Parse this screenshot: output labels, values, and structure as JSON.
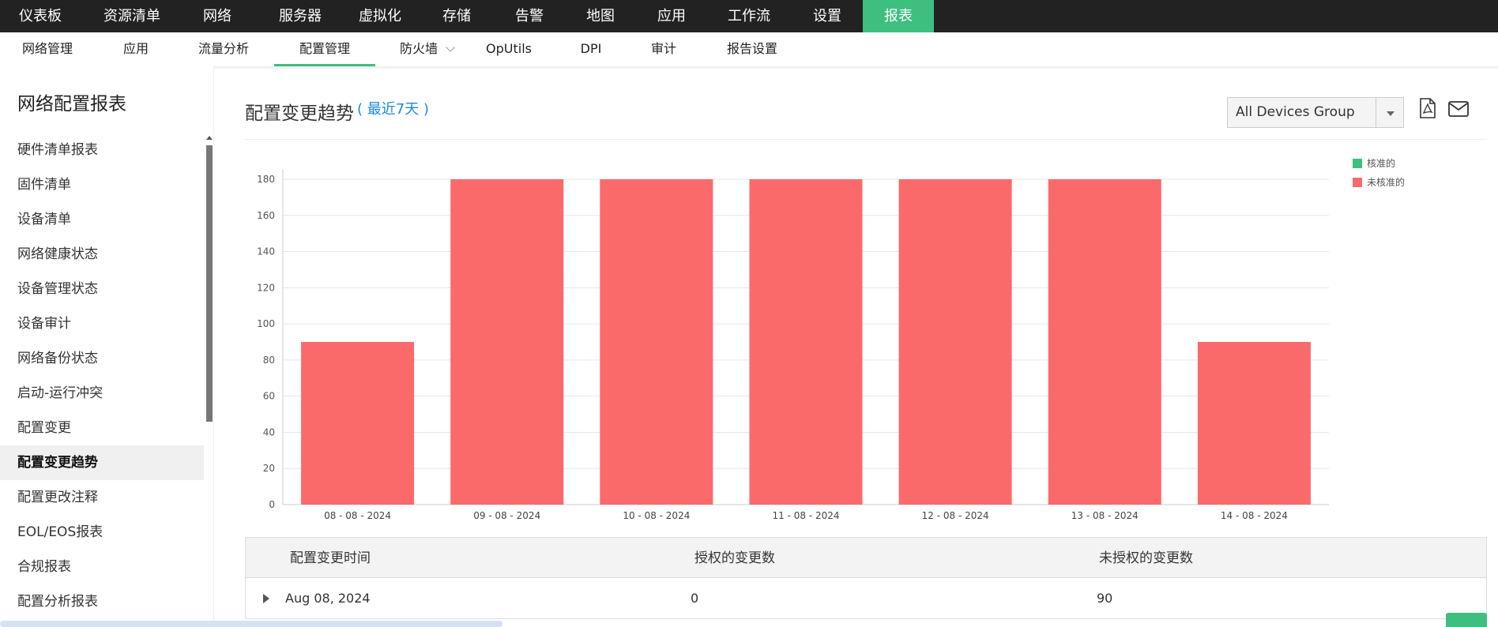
{
  "topnav": {
    "items": [
      "仪表板",
      "资源清单",
      "网络",
      "服务器",
      "虚拟化",
      "存储",
      "告警",
      "地图",
      "应用",
      "工作流",
      "设置",
      "报表"
    ],
    "active": "报表"
  },
  "subnav": {
    "items": [
      "网络管理",
      "应用",
      "流量分析",
      "配置管理",
      "防火墙",
      "OpUtils",
      "DPI",
      "审计",
      "报告设置"
    ],
    "active": "配置管理"
  },
  "sidebar": {
    "title": "网络配置报表",
    "items": [
      "硬件清单报表",
      "固件清单",
      "设备清单",
      "网络健康状态",
      "设备管理状态",
      "设备审计",
      "网络备份状态",
      "启动-运行冲突",
      "配置变更",
      "配置变更趋势",
      "配置更改注释",
      "EOL/EOS报表",
      "合规报表",
      "配置分析报表"
    ],
    "active": "配置变更趋势"
  },
  "main": {
    "title": "配置变更趋势",
    "period": "( 最近7天 )",
    "device_group": "All Devices Group",
    "icons": [
      "pdf-icon",
      "mail-icon"
    ]
  },
  "colors": {
    "accent": "#3fbf7f",
    "authorized": "#3fbf7f",
    "unauthorized": "#fb6a6a",
    "link": "#1e88e5"
  },
  "chart_data": {
    "type": "bar",
    "stacked": true,
    "categories": [
      "08 - 08 - 2024",
      "09 - 08 - 2024",
      "10 - 08 - 2024",
      "11 - 08 - 2024",
      "12 - 08 - 2024",
      "13 - 08 - 2024",
      "14 - 08 - 2024"
    ],
    "series": [
      {
        "name": "核准的",
        "values": [
          0,
          0,
          0,
          0,
          0,
          0,
          0
        ]
      },
      {
        "name": "未核准的",
        "values": [
          90,
          180,
          180,
          180,
          180,
          180,
          90
        ]
      }
    ],
    "ylim": [
      0,
      180
    ],
    "yticks": [
      0,
      20,
      40,
      60,
      80,
      100,
      120,
      140,
      160,
      180
    ],
    "legend": "top-right",
    "grid": true
  },
  "table": {
    "headers": [
      "配置变更时间",
      "授权的变更数",
      "未授权的变更数"
    ],
    "rows": [
      {
        "time": "Aug 08, 2024",
        "authorized": "0",
        "unauthorized": "90"
      }
    ]
  }
}
